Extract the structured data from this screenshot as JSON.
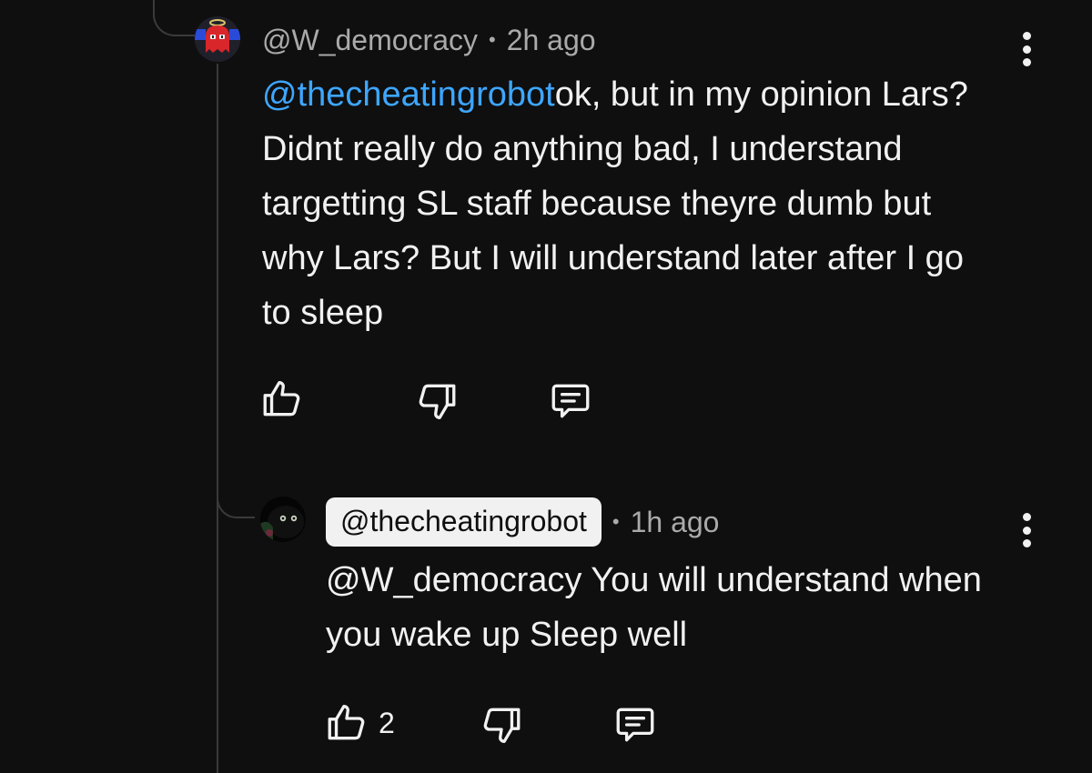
{
  "comments": [
    {
      "username": "@W_democracy",
      "separator": "•",
      "time": "2h ago",
      "mention": "@thecheatingrobot",
      "text": "ok, but in my opinion Lars? Didnt really do anything bad, I understand targetting SL staff because theyre dumb but why Lars? But I will understand later after I go to sleep"
    },
    {
      "username": "@thecheatingrobot",
      "separator": "•",
      "time": "1h ago",
      "text": "@W_democracy You will understand when you wake up Sleep well",
      "likes": "2"
    }
  ],
  "colors": {
    "background": "#0f0f0f",
    "mention": "#3ea6ff",
    "text": "#f1f1f1",
    "meta": "#aaaaaa"
  }
}
